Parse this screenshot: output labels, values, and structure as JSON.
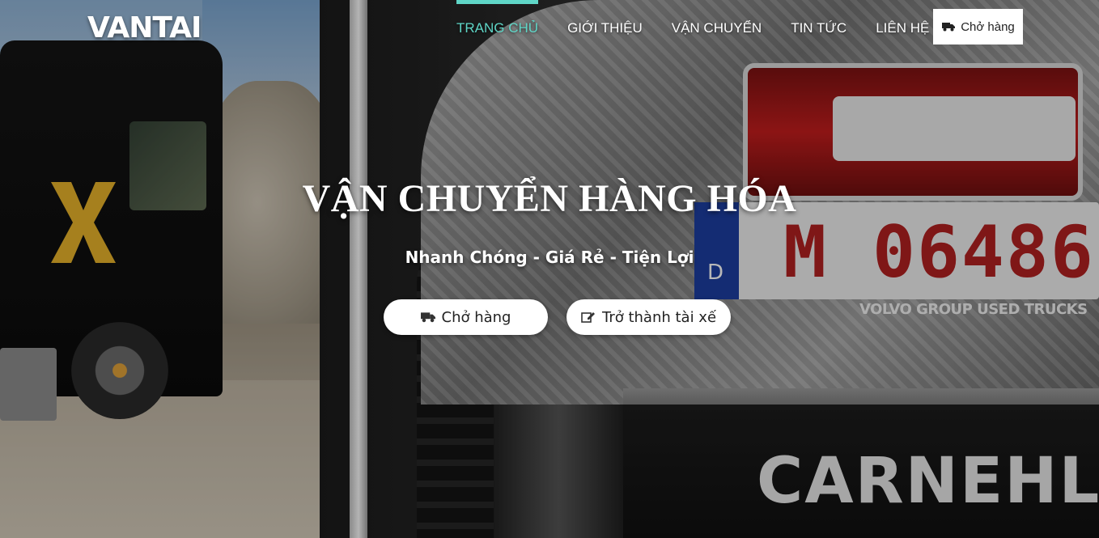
{
  "brand": {
    "logo": "VANTAI"
  },
  "nav": {
    "items": [
      {
        "label": "TRANG CHỦ",
        "active": true
      },
      {
        "label": "GIỚI THIỆU",
        "active": false
      },
      {
        "label": "VẬN CHUYỂN",
        "active": false
      },
      {
        "label": "TIN TỨC",
        "active": false
      },
      {
        "label": "LIÊN HỆ",
        "active": false
      }
    ],
    "cta_label": "Chở hàng",
    "cta_icon": "truck-icon",
    "active_color": "#5fd6c7"
  },
  "hero": {
    "title": "VẬN CHUYỂN HÀNG HÓA",
    "subtitle": "Nhanh Chóng - Giá Rẻ - Tiện Lợi",
    "primary_button": {
      "label": "Chở hàng",
      "icon": "truck-icon"
    },
    "secondary_button": {
      "label": "Trở thành tài xế",
      "icon": "edit-icon"
    }
  },
  "photo": {
    "plate_country": "D",
    "plate_number": "M 06486",
    "plate_caption": "VOLVO GROUP USED TRUCKS",
    "mudflap_brand": "CARNEHL"
  }
}
